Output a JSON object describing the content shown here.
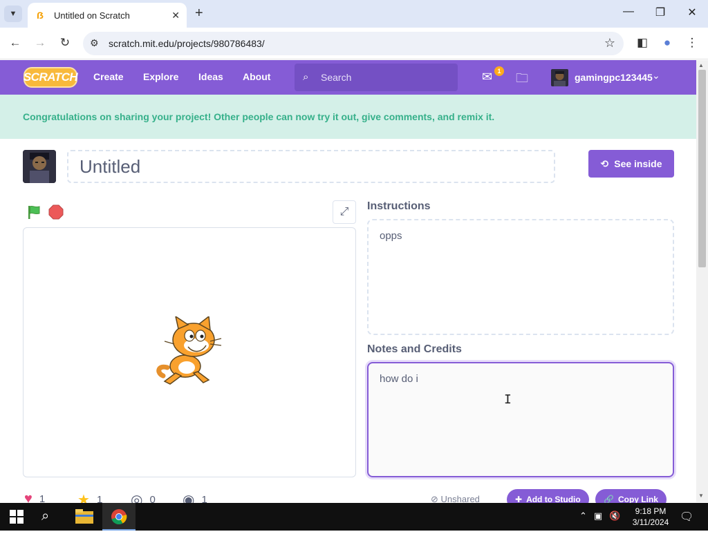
{
  "browser": {
    "tab_title": "Untitled on Scratch",
    "tab_close": "✕",
    "new_tab": "+",
    "url": "scratch.mit.edu/projects/980786483/",
    "window_controls": {
      "minimize": "—",
      "maximize": "❐",
      "close": "✕"
    }
  },
  "nav": {
    "logo": "SCRATCH",
    "links": [
      "Create",
      "Explore",
      "Ideas",
      "About"
    ],
    "search_placeholder": "Search",
    "message_count": "1",
    "username": "gamingpc123445"
  },
  "banner": {
    "text": "Congratulations on sharing your project! Other people can now try it out, give comments, and remix it."
  },
  "project": {
    "title": "Untitled",
    "see_inside": "See inside",
    "instructions_label": "Instructions",
    "instructions_value": "opps",
    "notes_label": "Notes and Credits",
    "notes_value": "how do i"
  },
  "stats": {
    "loves": "1",
    "favorites": "1",
    "remixes": "0",
    "views": "1",
    "unshared": "Unshared",
    "add_to_studio": "Add to Studio",
    "copy_link": "Copy Link"
  },
  "taskbar": {
    "time": "9:18 PM",
    "date": "3/11/2024"
  },
  "colors": {
    "scratch_purple": "#855cd6",
    "banner_bg": "#d4f0e8",
    "banner_text": "#36b08a",
    "love_red": "#e5447a",
    "favorite_yellow": "#ffc21a"
  }
}
